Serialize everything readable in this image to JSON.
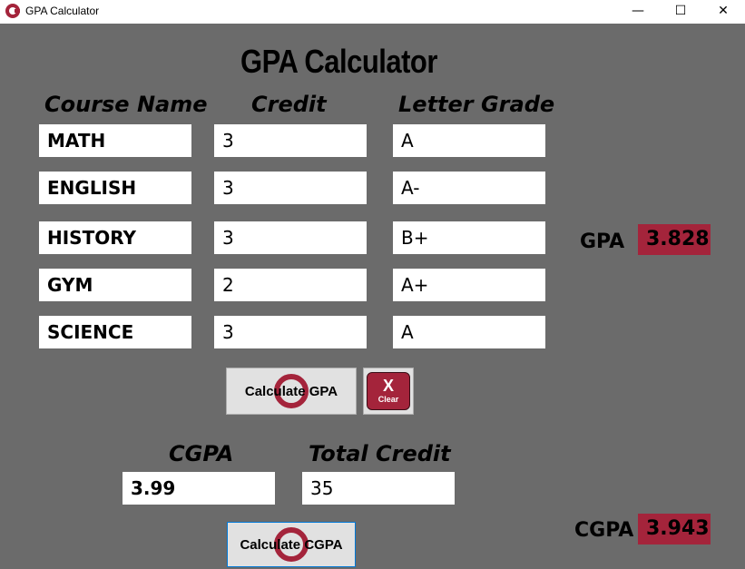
{
  "window": {
    "title": "GPA Calculator",
    "minimize_glyph": "—",
    "maximize_glyph": "☐",
    "close_glyph": "✕",
    "icon": "app-logo-icon"
  },
  "page_title": "GPA Calculator",
  "columns": {
    "course_name": "Course Name",
    "credit": "Credit",
    "letter_grade": "Letter Grade"
  },
  "courses": [
    {
      "name": "MATH",
      "credit": "3",
      "grade": "A"
    },
    {
      "name": "ENGLISH",
      "credit": "3",
      "grade": "A-"
    },
    {
      "name": "HISTORY",
      "credit": "3",
      "grade": "B+"
    },
    {
      "name": "GYM",
      "credit": "2",
      "grade": "A+"
    },
    {
      "name": "SCIENCE",
      "credit": "3",
      "grade": "A"
    }
  ],
  "gpa": {
    "label": "GPA",
    "value": "3.828"
  },
  "calculate_gpa_button": "Calculate GPA",
  "clear_button": {
    "glyph": "X",
    "label": "Clear"
  },
  "cgpa_section": {
    "cgpa_label": "CGPA",
    "total_credit_label": "Total Credit",
    "cgpa_input": "3.99",
    "total_credit_input": "35"
  },
  "calculate_cgpa_button": "Calculate CGPA",
  "cgpa_result": {
    "label": "CGPA",
    "value": "3.943"
  },
  "colors": {
    "accent": "#a4243b",
    "background": "#6b6b6b"
  }
}
